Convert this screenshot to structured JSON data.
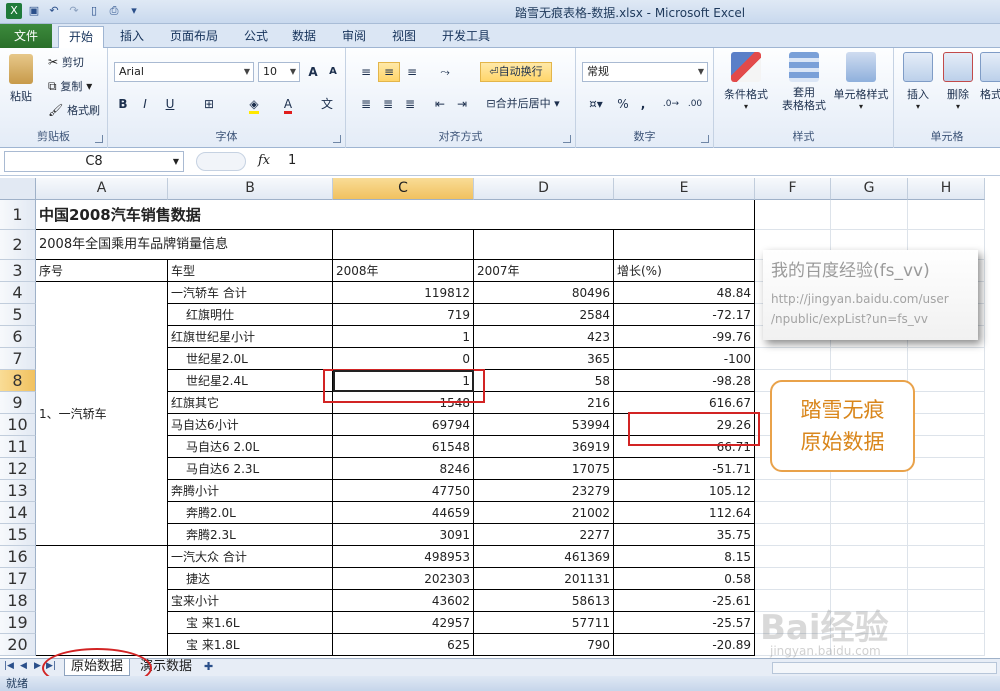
{
  "window": {
    "title": "踏雪无痕表格-数据.xlsx  -  Microsoft Excel"
  },
  "ribbon_tabs": [
    "文件",
    "开始",
    "插入",
    "页面布局",
    "公式",
    "数据",
    "审阅",
    "视图",
    "开发工具"
  ],
  "clipboard": {
    "paste": "粘贴",
    "cut": "剪切",
    "copy": "复制",
    "format_painter": "格式刷",
    "label": "剪贴板"
  },
  "font": {
    "name": "Arial",
    "size": "10",
    "grow": "A",
    "shrink": "A",
    "bold": "B",
    "italic": "I",
    "underline": "U",
    "label": "字体"
  },
  "alignment": {
    "wrap": "自动换行",
    "merge": "合并后居中",
    "label": "对齐方式"
  },
  "number": {
    "format": "常规",
    "percent": "%",
    "comma": ",",
    "label": "数字"
  },
  "styles": {
    "conditional": "条件格式",
    "table": "套用\n表格格式",
    "cell": "单元格样式",
    "label": "样式"
  },
  "cells": {
    "insert": "插入",
    "delete": "删除",
    "format": "格式",
    "label": "单元格"
  },
  "formula_bar": {
    "name_box": "C8",
    "fx": "fx",
    "value": "1"
  },
  "columns": [
    "A",
    "B",
    "C",
    "D",
    "E",
    "F",
    "G",
    "H"
  ],
  "rows": [
    "1",
    "2",
    "3",
    "4",
    "5",
    "6",
    "7",
    "8",
    "9",
    "10",
    "11",
    "12",
    "13",
    "14",
    "15",
    "16",
    "17",
    "18",
    "19",
    "20"
  ],
  "sheet": {
    "title": "中国2008汽车销售数据",
    "subtitle": "2008年全国乘用车品牌销量信息",
    "headers": {
      "seq": "序号",
      "model": "车型",
      "y2008": "2008年",
      "y2007": "2007年",
      "growth": "增长(%)"
    },
    "group1": "1、一汽轿车",
    "data": [
      {
        "model": "一汽轿车 合计",
        "y2008": "119812",
        "y2007": "80496",
        "growth": "48.84"
      },
      {
        "model": "红旗明仕",
        "y2008": "719",
        "y2007": "2584",
        "growth": "-72.17"
      },
      {
        "model": "红旗世纪星小计",
        "y2008": "1",
        "y2007": "423",
        "growth": "-99.76"
      },
      {
        "model": "世纪星2.0L",
        "y2008": "0",
        "y2007": "365",
        "growth": "-100"
      },
      {
        "model": "世纪星2.4L",
        "y2008": "1",
        "y2007": "58",
        "growth": "-98.28"
      },
      {
        "model": "红旗其它",
        "y2008": "1548",
        "y2007": "216",
        "growth": "616.67"
      },
      {
        "model": "马自达6小计",
        "y2008": "69794",
        "y2007": "53994",
        "growth": "29.26"
      },
      {
        "model": "马自达6 2.0L",
        "y2008": "61548",
        "y2007": "36919",
        "growth": "66.71"
      },
      {
        "model": "马自达6 2.3L",
        "y2008": "8246",
        "y2007": "17075",
        "growth": "-51.71"
      },
      {
        "model": "奔腾小计",
        "y2008": "47750",
        "y2007": "23279",
        "growth": "105.12"
      },
      {
        "model": "奔腾2.0L",
        "y2008": "44659",
        "y2007": "21002",
        "growth": "112.64"
      },
      {
        "model": "奔腾2.3L",
        "y2008": "3091",
        "y2007": "2277",
        "growth": "35.75"
      },
      {
        "model": "一汽大众 合计",
        "y2008": "498953",
        "y2007": "461369",
        "growth": "8.15"
      },
      {
        "model": "捷达",
        "y2008": "202303",
        "y2007": "201131",
        "growth": "0.58"
      },
      {
        "model": "宝来小计",
        "y2008": "43602",
        "y2007": "58613",
        "growth": "-25.61"
      },
      {
        "model": "宝 来1.6L",
        "y2008": "42957",
        "y2007": "57711",
        "growth": "-25.57"
      },
      {
        "model": "宝 来1.8L",
        "y2008": "625",
        "y2007": "790",
        "growth": "-20.89"
      }
    ]
  },
  "note": {
    "title": "我的百度经验(fs_vv)",
    "url1": "http://jingyan.baidu.com/user",
    "url2": "/npublic/expList?un=fs_vv"
  },
  "stamp": {
    "line1": "踏雪无痕",
    "line2": "原始数据"
  },
  "watermark": {
    "brand": "Bai经验",
    "url": "jingyan.baidu.com"
  },
  "sheet_tabs": [
    "原始数据",
    "演示数据"
  ],
  "status": "就绪"
}
